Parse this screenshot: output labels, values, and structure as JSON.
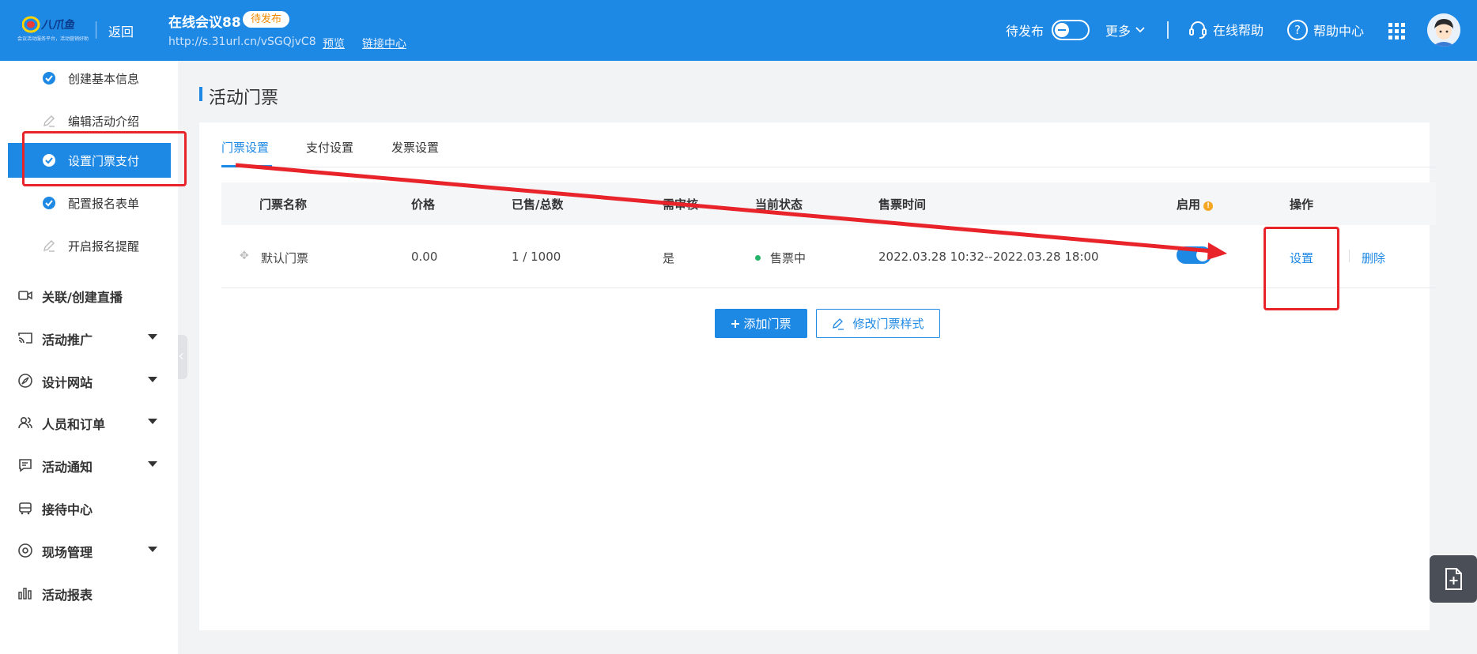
{
  "header": {
    "logo_slogan": "会议活动服务平台，活动营销好助手",
    "back_label": "返回",
    "event_title": "在线会议88",
    "status_tag": "待发布",
    "event_url": "http://s.31url.cn/vSGQjvC8",
    "preview_link": "预览",
    "link_center": "链接中心",
    "publish_toggle_label": "待发布",
    "more_label": "更多",
    "online_help_label": "在线帮助",
    "help_center_label": "帮助中心"
  },
  "sidebar": {
    "steps": [
      {
        "label": "创建基本信息",
        "state": "done"
      },
      {
        "label": "编辑活动介绍",
        "state": "todo"
      },
      {
        "label": "设置门票支付",
        "state": "active"
      },
      {
        "label": "配置报名表单",
        "state": "done"
      },
      {
        "label": "开启报名提醒",
        "state": "todo"
      }
    ],
    "nav": [
      {
        "label": "关联/创建直播",
        "icon": "video-icon",
        "expandable": false
      },
      {
        "label": "活动推广",
        "icon": "cast-icon",
        "expandable": true
      },
      {
        "label": "设计网站",
        "icon": "compass-icon",
        "expandable": true
      },
      {
        "label": "人员和订单",
        "icon": "people-icon",
        "expandable": true
      },
      {
        "label": "活动通知",
        "icon": "message-icon",
        "expandable": true
      },
      {
        "label": "接待中心",
        "icon": "bus-icon",
        "expandable": false
      },
      {
        "label": "现场管理",
        "icon": "target-icon",
        "expandable": true
      },
      {
        "label": "活动报表",
        "icon": "bar-chart-icon",
        "expandable": false
      }
    ]
  },
  "main": {
    "page_title": "活动门票",
    "tabs": [
      "门票设置",
      "支付设置",
      "发票设置"
    ],
    "active_tab": 0,
    "table": {
      "headers": [
        "门票名称",
        "价格",
        "已售/总数",
        "需审核",
        "当前状态",
        "售票时间",
        "启用",
        "操作"
      ],
      "rows": [
        {
          "name": "默认门票",
          "price": "0.00",
          "sold_total": "1 / 1000",
          "review": "是",
          "status": "售票中",
          "sale_time": "2022.03.28 10:32--2022.03.28 18:00",
          "enabled": true,
          "action_set": "设置",
          "action_delete": "删除"
        }
      ]
    },
    "add_ticket_button": "添加门票",
    "edit_style_button": "修改门票样式"
  },
  "colors": {
    "primary": "#1e88e5",
    "annotation_red": "#e8232a",
    "status_green": "#26b36a",
    "warning_orange": "#f5a623"
  }
}
